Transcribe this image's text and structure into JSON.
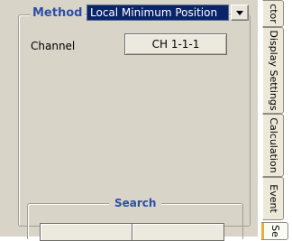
{
  "method": {
    "legend": "Method",
    "selected_value": "Local Minimum Position"
  },
  "channel": {
    "label": "Channel",
    "button_label": "CH 1-1-1"
  },
  "search": {
    "legend": "Search"
  },
  "tabs": [
    {
      "label": "ctor"
    },
    {
      "label": "Display Settings"
    },
    {
      "label": "Calculation"
    },
    {
      "label": "Event"
    },
    {
      "label": "Se"
    }
  ]
}
